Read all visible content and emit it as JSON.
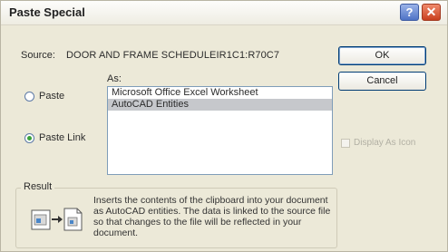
{
  "window": {
    "title": "Paste Special"
  },
  "source": {
    "label": "Source:",
    "value": "DOOR AND FRAME SCHEDULEIR1C1:R70C7"
  },
  "as": {
    "label": "As:",
    "items": [
      {
        "label": "Microsoft Office Excel Worksheet",
        "selected": false
      },
      {
        "label": "AutoCAD Entities",
        "selected": true
      }
    ]
  },
  "options": {
    "paste_label": "Paste",
    "paste_link_label": "Paste Link",
    "selected": "Paste Link"
  },
  "buttons": {
    "ok_label": "OK",
    "cancel_label": "Cancel"
  },
  "display_as_icon": {
    "label": "Display As Icon",
    "checked": false,
    "enabled": false
  },
  "result": {
    "label": "Result",
    "text": "Inserts the contents of the clipboard into your document as AutoCAD entities.  The data is linked to the source file so that changes to the file will be reflected in your document."
  },
  "colors": {
    "dialog_bg": "#ece9d8",
    "selection_bg": "#c6c8cc",
    "radio_dot": "#3aa13a",
    "close_button": "#c9401e"
  }
}
